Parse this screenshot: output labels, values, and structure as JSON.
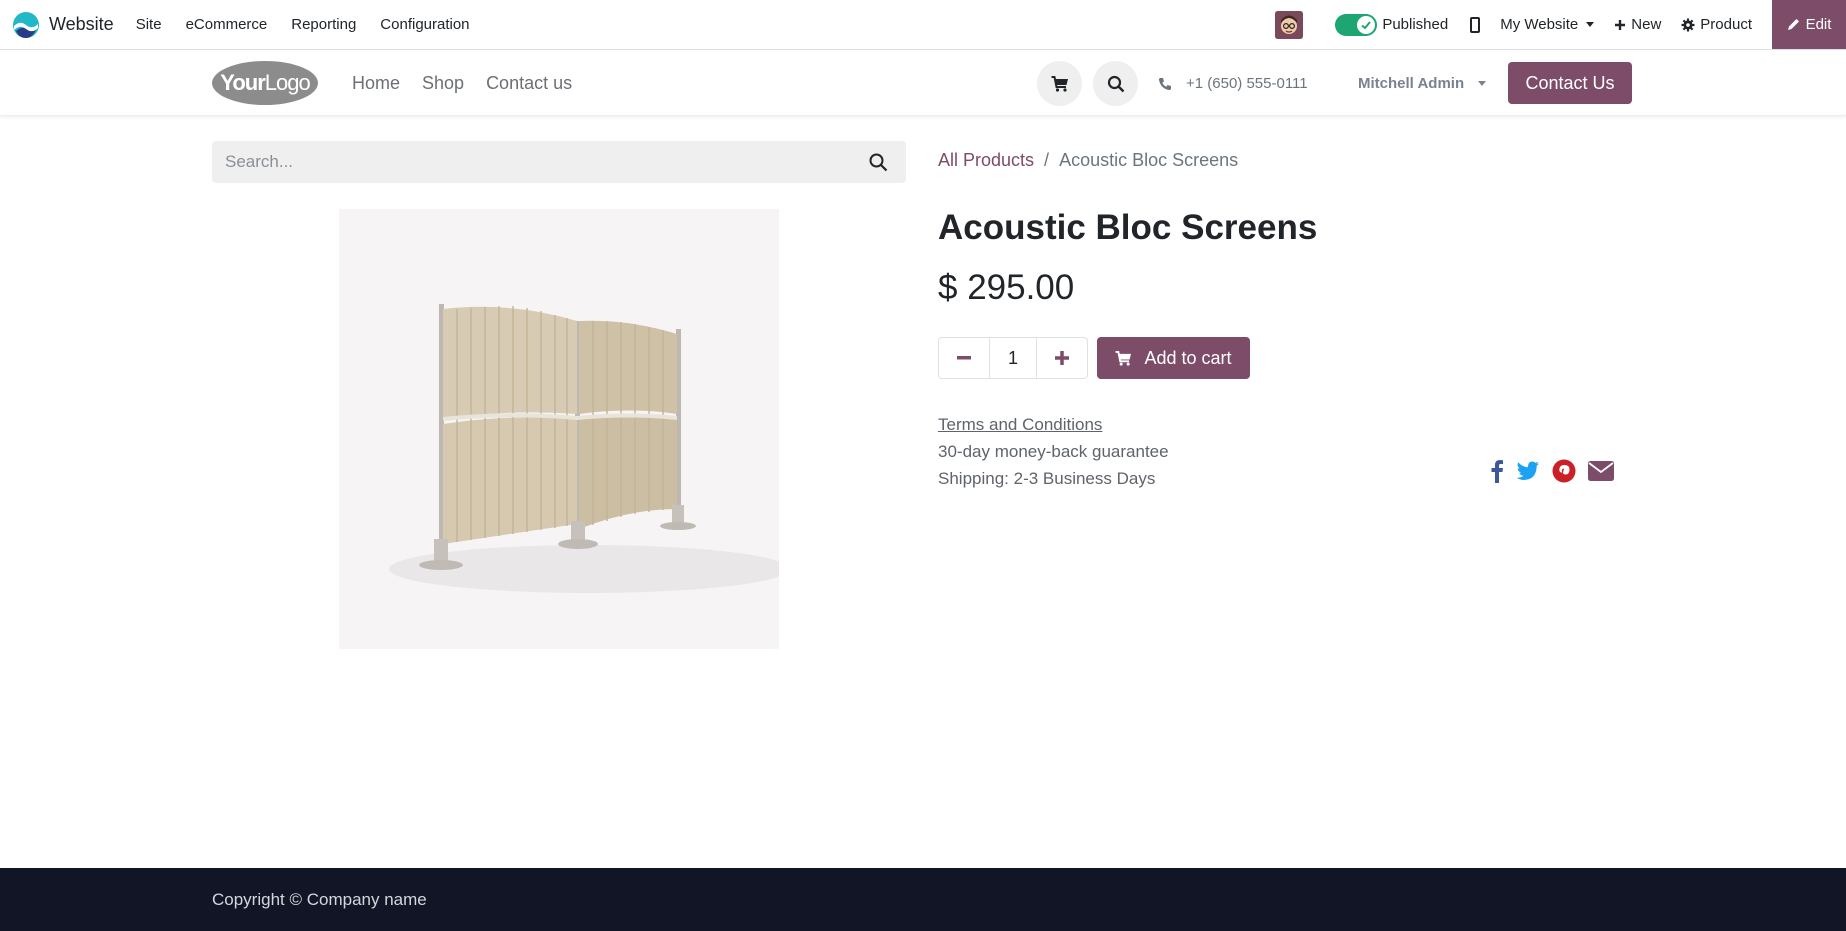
{
  "admin_bar": {
    "app_name": "Website",
    "menu": [
      "Site",
      "eCommerce",
      "Reporting",
      "Configuration"
    ],
    "published_label": "Published",
    "my_website_label": "My Website",
    "new_label": "New",
    "product_label": "Product",
    "edit_label": "Edit"
  },
  "header": {
    "logo_bold": "Your",
    "logo_light": "Logo",
    "nav": [
      "Home",
      "Shop",
      "Contact us"
    ],
    "phone": "+1 (650) 555-0111",
    "user": "Mitchell Admin",
    "contact_button": "Contact Us"
  },
  "search": {
    "placeholder": "Search..."
  },
  "breadcrumb": {
    "parent": "All Products",
    "separator": "/",
    "current": "Acoustic Bloc Screens"
  },
  "product": {
    "title": "Acoustic Bloc Screens",
    "price": "$ 295.00",
    "quantity": "1",
    "add_to_cart": "Add to cart",
    "terms": "Terms and Conditions",
    "guarantee": "30-day money-back guarantee",
    "shipping": "Shipping: 2-3 Business Days"
  },
  "share_icons": [
    "facebook-icon",
    "twitter-icon",
    "pinterest-icon",
    "envelope-icon"
  ],
  "colors": {
    "brand": "#7d4c69",
    "toggle_on": "#1ea672",
    "footer_bg": "#121526"
  },
  "footer": {
    "copyright": "Copyright © Company name"
  }
}
